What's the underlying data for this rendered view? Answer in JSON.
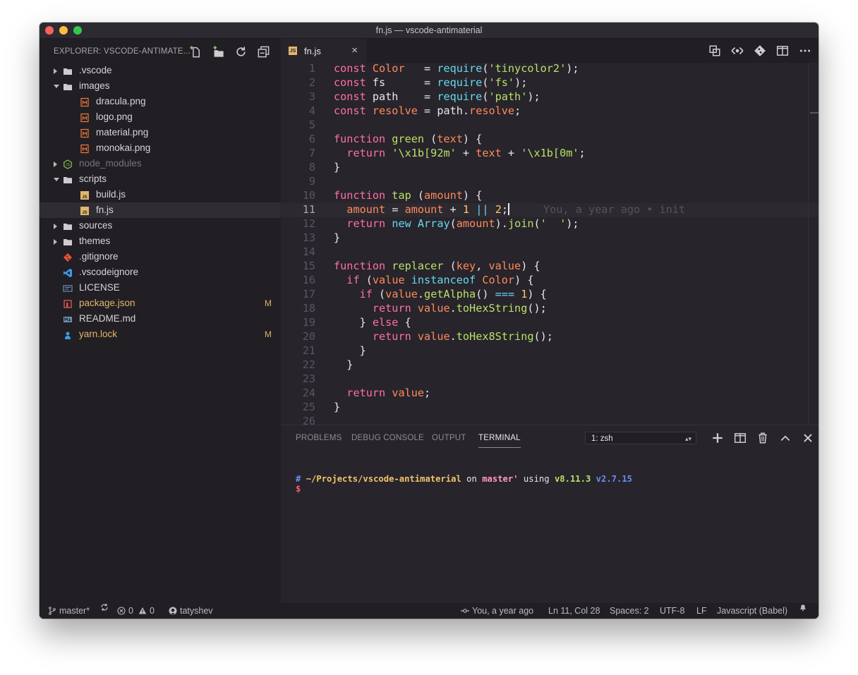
{
  "window": {
    "title": "fn.js — vscode-antimaterial"
  },
  "sidebar": {
    "header": "EXPLORER: VSCODE-ANTIMATE...",
    "actions": [
      "new-file-icon",
      "new-folder-icon",
      "refresh-icon",
      "collapse-all-icon"
    ],
    "items": [
      {
        "label": ".vscode",
        "type": "folder",
        "depth": 0,
        "state": "closed"
      },
      {
        "label": "images",
        "type": "folder",
        "depth": 0,
        "state": "open"
      },
      {
        "label": "dracula.png",
        "type": "image",
        "depth": 1
      },
      {
        "label": "logo.png",
        "type": "image",
        "depth": 1
      },
      {
        "label": "material.png",
        "type": "image",
        "depth": 1
      },
      {
        "label": "monokai.png",
        "type": "image",
        "depth": 1
      },
      {
        "label": "node_modules",
        "type": "folder-node",
        "depth": 0,
        "state": "closed",
        "dim": true
      },
      {
        "label": "scripts",
        "type": "folder",
        "depth": 0,
        "state": "open"
      },
      {
        "label": "build.js",
        "type": "js",
        "depth": 1
      },
      {
        "label": "fn.js",
        "type": "js",
        "depth": 1,
        "selected": true
      },
      {
        "label": "sources",
        "type": "folder",
        "depth": 0,
        "state": "closed"
      },
      {
        "label": "themes",
        "type": "folder",
        "depth": 0,
        "state": "closed"
      },
      {
        "label": ".gitignore",
        "type": "git",
        "depth": 0
      },
      {
        "label": ".vscodeignore",
        "type": "vscode",
        "depth": 0
      },
      {
        "label": "LICENSE",
        "type": "license",
        "depth": 0
      },
      {
        "label": "package.json",
        "type": "npm",
        "depth": 0,
        "badge": "M",
        "modified": true
      },
      {
        "label": "README.md",
        "type": "markdown",
        "depth": 0
      },
      {
        "label": "yarn.lock",
        "type": "yarn",
        "depth": 0,
        "badge": "M",
        "modified": true
      }
    ]
  },
  "editor": {
    "tab": {
      "label": "fn.js",
      "icon": "js-file-icon",
      "close": "×"
    },
    "actions": [
      "open-changes-icon",
      "toggle-blame-icon",
      "git-compare-icon",
      "split-editor-icon",
      "more-actions-icon"
    ],
    "current_line": 11,
    "blame": "You, a year ago • init",
    "lines": [
      [
        [
          "k",
          "const "
        ],
        [
          "v",
          "Color"
        ],
        [
          "p",
          "   = "
        ],
        [
          "c",
          "require"
        ],
        [
          "p",
          "("
        ],
        [
          "s",
          "'tinycolor2'"
        ],
        [
          "p",
          ");"
        ]
      ],
      [
        [
          "k",
          "const "
        ],
        [
          "p",
          "fs      = "
        ],
        [
          "c",
          "require"
        ],
        [
          "p",
          "("
        ],
        [
          "s",
          "'fs'"
        ],
        [
          "p",
          ");"
        ]
      ],
      [
        [
          "k",
          "const "
        ],
        [
          "p",
          "path    = "
        ],
        [
          "c",
          "require"
        ],
        [
          "p",
          "("
        ],
        [
          "s",
          "'path'"
        ],
        [
          "p",
          ");"
        ]
      ],
      [
        [
          "k",
          "const "
        ],
        [
          "v",
          "resolve"
        ],
        [
          "p",
          " = path."
        ],
        [
          "v",
          "resolve"
        ],
        [
          "p",
          ";"
        ]
      ],
      [],
      [
        [
          "k",
          "function "
        ],
        [
          "fn",
          "green"
        ],
        [
          "p",
          " ("
        ],
        [
          "v",
          "text"
        ],
        [
          "p",
          ") {"
        ]
      ],
      [
        [
          "p",
          "  "
        ],
        [
          "k",
          "return "
        ],
        [
          "s",
          "'\\x1b[92m'"
        ],
        [
          "p",
          " + "
        ],
        [
          "v",
          "text"
        ],
        [
          "p",
          " + "
        ],
        [
          "s",
          "'\\x1b[0m'"
        ],
        [
          "p",
          ";"
        ]
      ],
      [
        [
          "p",
          "}"
        ]
      ],
      [],
      [
        [
          "k",
          "function "
        ],
        [
          "fn",
          "tap"
        ],
        [
          "p",
          " ("
        ],
        [
          "v",
          "amount"
        ],
        [
          "p",
          ") {"
        ]
      ],
      [
        [
          "p",
          "  "
        ],
        [
          "v",
          "amount"
        ],
        [
          "p",
          " = "
        ],
        [
          "v",
          "amount"
        ],
        [
          "p",
          " + "
        ],
        [
          "n",
          "1"
        ],
        [
          "p",
          " "
        ],
        [
          "c",
          "||"
        ],
        [
          "p",
          " "
        ],
        [
          "n",
          "2"
        ],
        [
          "p",
          ";"
        ]
      ],
      [
        [
          "p",
          "  "
        ],
        [
          "k",
          "return "
        ],
        [
          "c",
          "new "
        ],
        [
          "c",
          "Array"
        ],
        [
          "p",
          "("
        ],
        [
          "v",
          "amount"
        ],
        [
          "p",
          ")."
        ],
        [
          "fn",
          "join"
        ],
        [
          "p",
          "("
        ],
        [
          "s",
          "'  '"
        ],
        [
          "p",
          ");"
        ]
      ],
      [
        [
          "p",
          "}"
        ]
      ],
      [],
      [
        [
          "k",
          "function "
        ],
        [
          "fn",
          "replacer"
        ],
        [
          "p",
          " ("
        ],
        [
          "v",
          "key"
        ],
        [
          "p",
          ", "
        ],
        [
          "v",
          "value"
        ],
        [
          "p",
          ") {"
        ]
      ],
      [
        [
          "p",
          "  "
        ],
        [
          "k",
          "if "
        ],
        [
          "p",
          "("
        ],
        [
          "v",
          "value"
        ],
        [
          "p",
          " "
        ],
        [
          "c",
          "instanceof "
        ],
        [
          "v",
          "Color"
        ],
        [
          "p",
          ") {"
        ]
      ],
      [
        [
          "p",
          "    "
        ],
        [
          "k",
          "if "
        ],
        [
          "p",
          "("
        ],
        [
          "v",
          "value"
        ],
        [
          "p",
          "."
        ],
        [
          "fn",
          "getAlpha"
        ],
        [
          "p",
          "() "
        ],
        [
          "c",
          "==="
        ],
        [
          "p",
          " "
        ],
        [
          "n",
          "1"
        ],
        [
          "p",
          ") {"
        ]
      ],
      [
        [
          "p",
          "      "
        ],
        [
          "k",
          "return "
        ],
        [
          "v",
          "value"
        ],
        [
          "p",
          "."
        ],
        [
          "fn",
          "toHexString"
        ],
        [
          "p",
          "();"
        ]
      ],
      [
        [
          "p",
          "    } "
        ],
        [
          "k",
          "else "
        ],
        [
          "p",
          "{"
        ]
      ],
      [
        [
          "p",
          "      "
        ],
        [
          "k",
          "return "
        ],
        [
          "v",
          "value"
        ],
        [
          "p",
          "."
        ],
        [
          "fn",
          "toHex8String"
        ],
        [
          "p",
          "();"
        ]
      ],
      [
        [
          "p",
          "    }"
        ]
      ],
      [
        [
          "p",
          "  }"
        ]
      ],
      [],
      [
        [
          "p",
          "  "
        ],
        [
          "k",
          "return "
        ],
        [
          "v",
          "value"
        ],
        [
          "p",
          ";"
        ]
      ],
      [
        [
          "p",
          "}"
        ]
      ],
      []
    ]
  },
  "panel": {
    "tabs": [
      "PROBLEMS",
      "DEBUG CONSOLE",
      "OUTPUT",
      "TERMINAL"
    ],
    "active_tab": "TERMINAL",
    "terminal_select": "1: zsh",
    "actions": [
      "new-terminal-icon",
      "split-terminal-icon",
      "kill-terminal-icon",
      "maximize-panel-icon",
      "close-panel-icon"
    ],
    "terminal": {
      "prompt_hash": "#",
      "path": "~/Projects/vscode-antimaterial",
      "on_text": "on",
      "branch": "master'",
      "using_text": "using",
      "node_version": "v8.11.3",
      "python_version": "v2.7.15",
      "dollar": "$"
    }
  },
  "statusbar": {
    "branch": "master*",
    "errors": "0",
    "warnings": "0",
    "user": "tatyshev",
    "blame": "You, a year ago",
    "position": "Ln 11, Col 28",
    "spaces": "Spaces: 2",
    "encoding": "UTF-8",
    "eol": "LF",
    "language": "Javascript (Babel)"
  },
  "colors": {
    "background": "#27242b",
    "sidebar": "#211f24",
    "keyword": "#ff6fa6",
    "variable": "#ff8a5c",
    "function": "#b8e068",
    "number": "#ffc66d",
    "operator": "#66d9ef",
    "modified": "#e2b66c"
  }
}
